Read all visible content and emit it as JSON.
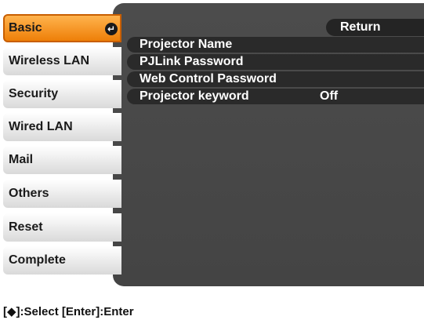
{
  "menu": {
    "items": [
      {
        "label": "Basic",
        "selected": true
      },
      {
        "label": "Wireless LAN"
      },
      {
        "label": "Security"
      },
      {
        "label": "Wired LAN"
      },
      {
        "label": "Mail"
      },
      {
        "label": "Others"
      },
      {
        "label": "Reset"
      },
      {
        "label": "Complete"
      }
    ],
    "selected_icon": "enter-icon"
  },
  "main": {
    "return_label": "Return",
    "rows": [
      {
        "label": "Projector Name",
        "value": ""
      },
      {
        "label": "PJLink Password",
        "value": ""
      },
      {
        "label": "Web Control Password",
        "value": ""
      },
      {
        "label": "Projector keyword",
        "value": "Off"
      }
    ]
  },
  "status_bar": {
    "text": "[◆]:Select [Enter]:Enter"
  },
  "colors": {
    "selected_accent": "#f08a1c",
    "panel_background": "#474747",
    "row_background": "#2a2a2a"
  }
}
